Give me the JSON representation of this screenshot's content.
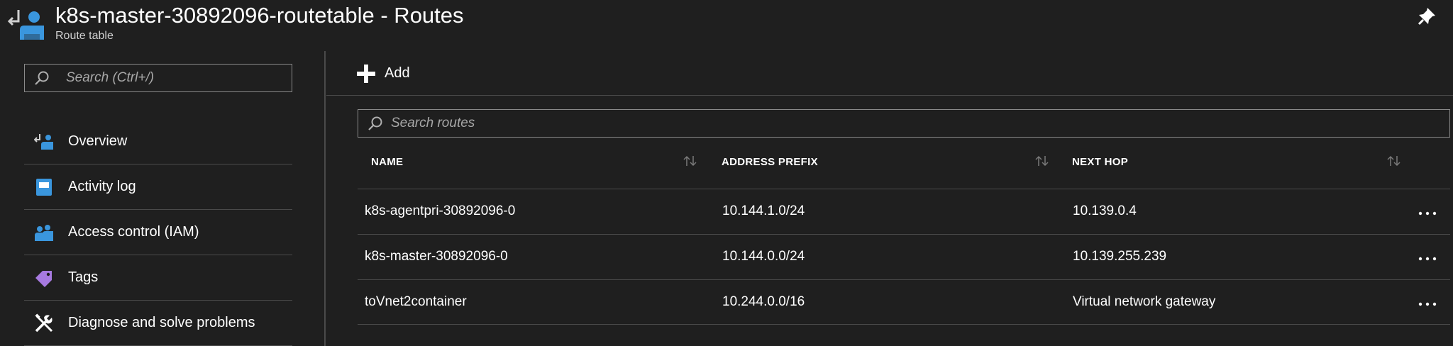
{
  "header": {
    "title": "k8s-master-30892096-routetable - Routes",
    "subtitle": "Route table",
    "icon": "route-table-icon",
    "pin_icon": "pin-icon"
  },
  "sidebar": {
    "search_placeholder": "Search (Ctrl+/)",
    "items": [
      {
        "label": "Overview",
        "icon": "overview-icon"
      },
      {
        "label": "Activity log",
        "icon": "activity-log-icon"
      },
      {
        "label": "Access control (IAM)",
        "icon": "access-control-icon"
      },
      {
        "label": "Tags",
        "icon": "tag-icon"
      },
      {
        "label": "Diagnose and solve problems",
        "icon": "wrench-icon"
      }
    ]
  },
  "main": {
    "add_label": "Add",
    "search_placeholder": "Search routes",
    "columns": [
      "NAME",
      "ADDRESS PREFIX",
      "NEXT HOP"
    ],
    "rows": [
      {
        "name": "k8s-agentpri-30892096-0",
        "prefix": "10.144.1.0/24",
        "next_hop": "10.139.0.4"
      },
      {
        "name": "k8s-master-30892096-0",
        "prefix": "10.144.0.0/24",
        "next_hop": "10.139.255.239"
      },
      {
        "name": "toVnet2container",
        "prefix": "10.244.0.0/16",
        "next_hop": "Virtual network gateway"
      }
    ]
  },
  "colors": {
    "background": "#1f1f1f",
    "accent_blue": "#3a96dd",
    "tag_purple": "#a77ae0",
    "divider": "#4a4a4a"
  }
}
